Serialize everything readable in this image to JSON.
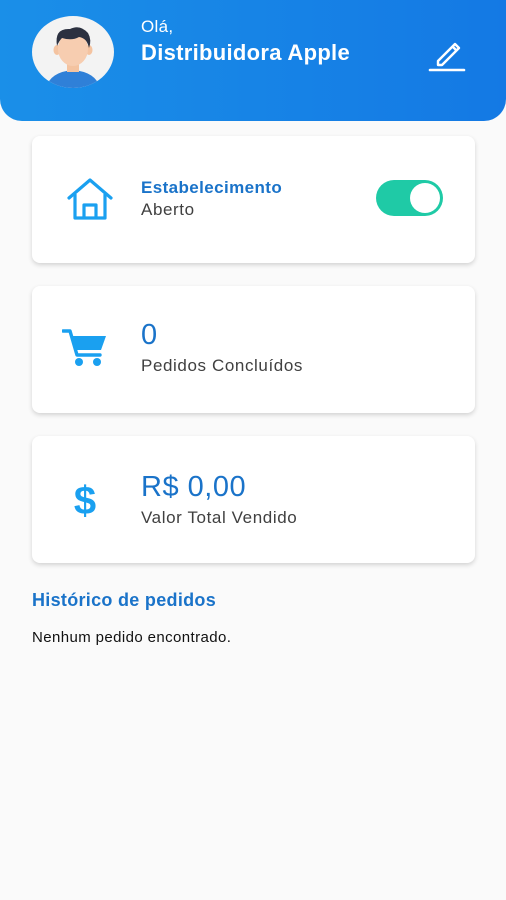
{
  "header": {
    "greeting": "Olá,",
    "user_name": "Distribuidora Apple",
    "avatar": "user-avatar",
    "edit_icon": "pencil-icon"
  },
  "cards": {
    "establishment": {
      "icon": "home-icon",
      "title": "Estabelecimento",
      "status": "Aberto",
      "toggle_on": true
    },
    "orders": {
      "icon": "cart-icon",
      "count": "0",
      "label": "Pedidos Concluídos"
    },
    "sales": {
      "icon": "dollar-icon",
      "amount": "R$ 0,00",
      "label": "Valor Total Vendido"
    }
  },
  "history": {
    "title": "Histórico de pedidos",
    "empty_message": "Nenhum pedido encontrado."
  },
  "colors": {
    "header_blue": "#1479e4",
    "accent_blue": "#1a73c9",
    "icon_blue": "#1aa0f0",
    "toggle_green": "#1fcaa6"
  }
}
